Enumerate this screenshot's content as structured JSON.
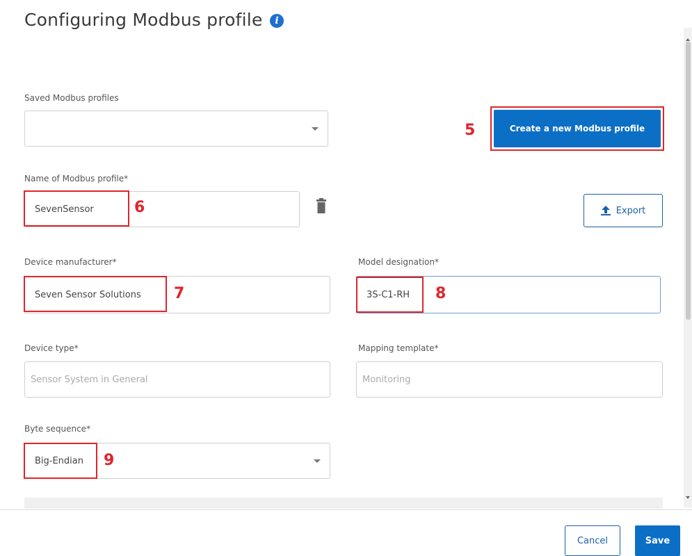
{
  "dialog": {
    "title": "Configuring Modbus profile",
    "info_icon": "info-icon"
  },
  "saved_profiles": {
    "label": "Saved Modbus profiles",
    "value": ""
  },
  "create_button": {
    "label": "Create a new Modbus profile"
  },
  "profile_name": {
    "label": "Name of Modbus profile*",
    "value": "SevenSensor"
  },
  "export_button": {
    "label": "Export",
    "icon": "upload-icon"
  },
  "delete_icon": "trash-icon",
  "manufacturer": {
    "label": "Device manufacturer*",
    "value": "Seven Sensor Solutions"
  },
  "model": {
    "label": "Model designation*",
    "value": "3S-C1-RH"
  },
  "device_type": {
    "label": "Device type*",
    "placeholder": "Sensor System in General"
  },
  "mapping_template": {
    "label": "Mapping template*",
    "placeholder": "Monitoring"
  },
  "byte_sequence": {
    "label": "Byte sequence*",
    "value": "Big-Endian"
  },
  "footer": {
    "cancel_label": "Cancel",
    "save_label": "Save"
  },
  "callouts": [
    "5",
    "6",
    "7",
    "8",
    "9"
  ],
  "colors": {
    "primary": "#0c6fc6",
    "callout": "#e0242a",
    "border": "#cfcfcf"
  }
}
